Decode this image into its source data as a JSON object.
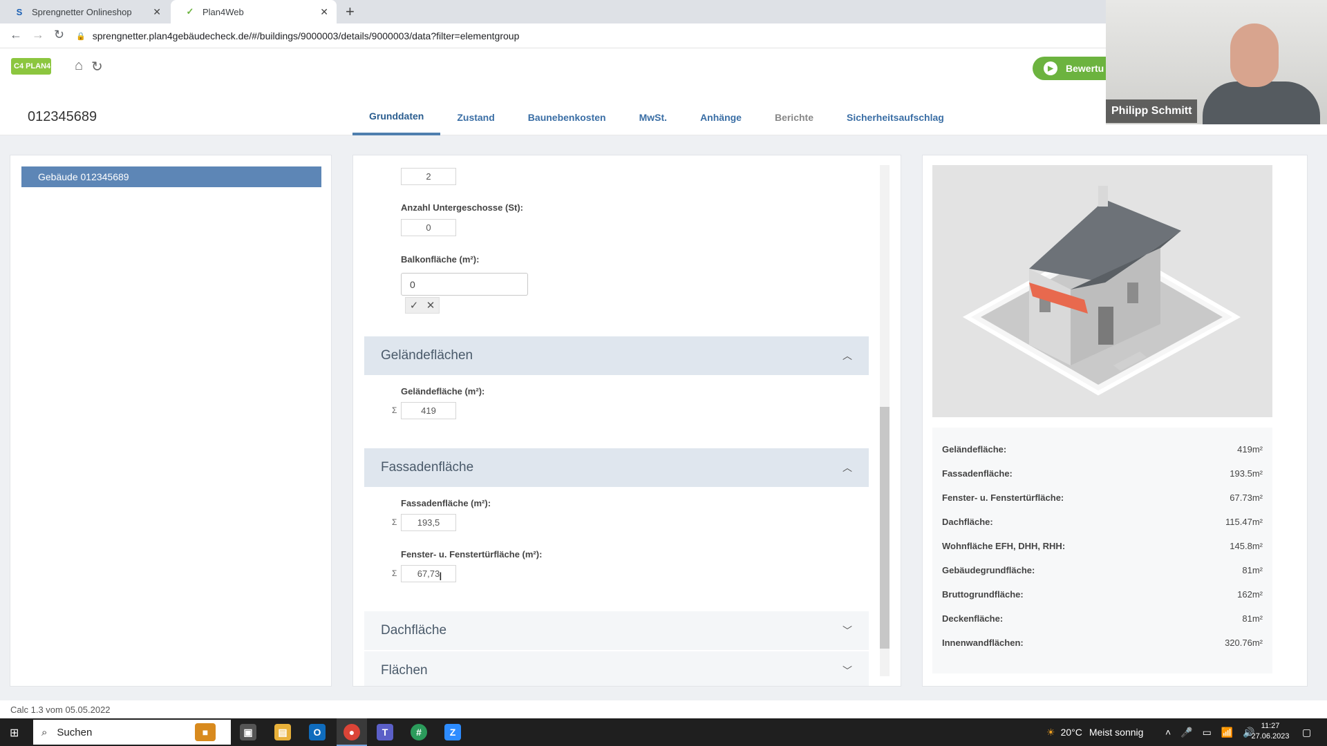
{
  "browser": {
    "tabs": [
      {
        "icon": "S",
        "label": "Sprengnetter Onlineshop"
      },
      {
        "icon": "✓",
        "label": "Plan4Web"
      }
    ],
    "url": "sprengnetter.plan4gebäudecheck.de/#/buildings/9000003/details/9000003/data?filter=elementgroup"
  },
  "header": {
    "logo_text": "C4 PLAN4",
    "bewertung_label": "Bewertu"
  },
  "building": {
    "id": "012345689"
  },
  "nav_tabs": [
    {
      "label": "Grunddaten"
    },
    {
      "label": "Zustand"
    },
    {
      "label": "Baunebenkosten"
    },
    {
      "label": "MwSt."
    },
    {
      "label": "Anhänge"
    },
    {
      "label": "Berichte"
    },
    {
      "label": "Sicherheitsaufschlag"
    }
  ],
  "tree": {
    "item": "Gebäude 012345689"
  },
  "form": {
    "top_value": "2",
    "untergeschosse_label": "Anzahl Untergeschosse (St):",
    "untergeschosse_value": "0",
    "balkon_label": "Balkonfläche (m²):",
    "balkon_value": "0",
    "sigma": "Σ",
    "sections": {
      "gelaende": "Geländeflächen",
      "fassade": "Fassadenfläche",
      "dach": "Dachfläche",
      "flaechen": "Flächen"
    },
    "gelaende_label": "Geländefläche (m²):",
    "gelaende_value": "419",
    "fassade_label": "Fassadenfläche (m²):",
    "fassade_value": "193,5",
    "fenster_label": "Fenster- u. Fenstertürfläche (m²):",
    "fenster_value": "67,73"
  },
  "stats": [
    {
      "label": "Geländefläche:",
      "value": "419m²"
    },
    {
      "label": "Fassadenfläche:",
      "value": "193.5m²"
    },
    {
      "label": "Fenster- u. Fenstertürfläche:",
      "value": "67.73m²"
    },
    {
      "label": "Dachfläche:",
      "value": "115.47m²"
    },
    {
      "label": "Wohnfläche EFH, DHH, RHH:",
      "value": "145.8m²"
    },
    {
      "label": "Gebäudegrundfläche:",
      "value": "81m²"
    },
    {
      "label": "Bruttogrundfläche:",
      "value": "162m²"
    },
    {
      "label": "Deckenfläche:",
      "value": "81m²"
    },
    {
      "label": "Innenwandflächen:",
      "value": "320.76m²"
    }
  ],
  "footer": {
    "version": "Calc 1.3 vom 05.05.2022"
  },
  "webcam": {
    "name": "Philipp Schmitt"
  },
  "taskbar": {
    "search_label": "Suchen",
    "weather_temp": "20°C",
    "weather_text": "Meist sonnig",
    "time": "11:27",
    "date": "27.06.2023"
  },
  "colors": {
    "accent_blue": "#5d86b6",
    "accent_green": "#6cb33f",
    "section_bg": "#dfe6ee"
  }
}
